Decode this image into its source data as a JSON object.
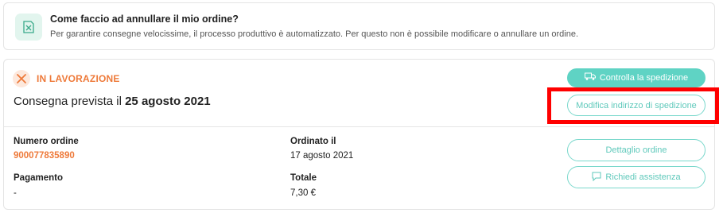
{
  "info": {
    "title": "Come faccio ad annullare il mio ordine?",
    "text": "Per garantire consegne velocissime, il processo produttivo è automatizzato. Per questo non è possibile modificare o annullare un ordine."
  },
  "order": {
    "status": "IN LAVORAZIONE",
    "delivery_prefix": "Consegna prevista il",
    "delivery_date": "25 agosto 2021",
    "fields": {
      "order_number_label": "Numero ordine",
      "order_number_value": "900077835890",
      "ordered_label": "Ordinato il",
      "ordered_value": "17 agosto 2021",
      "payment_label": "Pagamento",
      "payment_value": "-",
      "total_label": "Totale",
      "total_value": "7,30 €"
    },
    "buttons": {
      "track": "Controlla la spedizione",
      "address": "Modifica indirizzo di spedizione",
      "detail": "Dettaglio ordine",
      "help": "Richiedi assistenza"
    }
  },
  "colors": {
    "accent_teal": "#5fd3c4",
    "status_orange": "#ee7a3a",
    "highlight_red": "#ff0000"
  },
  "icons": [
    "cancel-order-icon",
    "tools-icon",
    "truck-icon",
    "chat-help-icon"
  ]
}
